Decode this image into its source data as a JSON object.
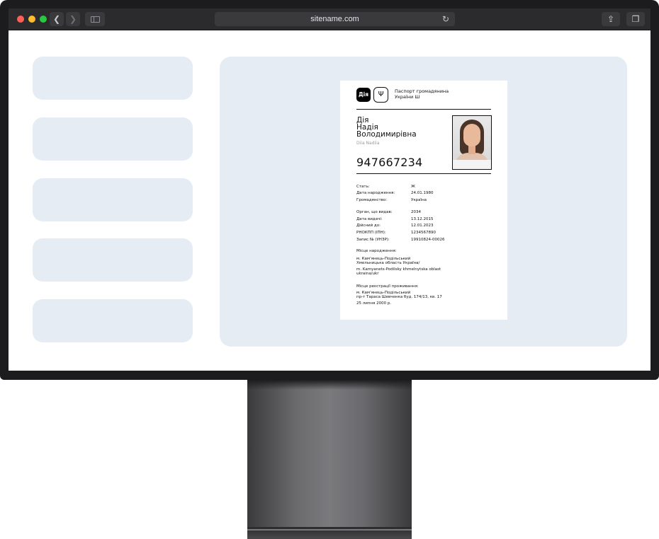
{
  "browser": {
    "url": "sitename.com",
    "icons": {
      "back": "chevron-left-icon",
      "forward": "chevron-right-icon",
      "sidebar": "sidebar-icon",
      "reload": "reload-icon",
      "share": "share-icon",
      "tabs": "tabs-icon"
    }
  },
  "colors": {
    "panel": "#e6ecf3",
    "frame": "#1c1c1e",
    "close": "#ff5f57",
    "minimize": "#febc2e",
    "zoom": "#28c840"
  },
  "document": {
    "logo_text": "Дія",
    "title_line1": "Паспорт громадянина",
    "title_line2": "України Ш",
    "surname": "Дія",
    "given_name": "Надія",
    "patronymic": "Володимирівна",
    "latin_name": "Diia Nadiia",
    "number": "947667234",
    "fields_group1": [
      {
        "label": "Стать:",
        "value": "Ж"
      },
      {
        "label": "Дата народження:",
        "value": "24.01.1980"
      },
      {
        "label": "Громадянство:",
        "value": "Україна"
      }
    ],
    "fields_group2": [
      {
        "label": "Орган, що видав:",
        "value": "2034"
      },
      {
        "label": "Дата видачі:",
        "value": "13.12.2015"
      },
      {
        "label": "Дійсний до:",
        "value": "12.01.2023"
      },
      {
        "label": "РНОКПП (ІПН):",
        "value": "1234567890"
      },
      {
        "label": "Запис № (УНЗР):",
        "value": "19910824-00026"
      }
    ],
    "birthplace_label": "Місце народження:",
    "birthplace_line1": "м. Кам'янець-Подільський",
    "birthplace_line2": "Хмельницька область Україна/",
    "birthplace_line3": "m. Kamyanets-Podilsky khmelnytska oblast",
    "birthplace_line4": "ukraina/ukr",
    "residence_label": "Місце реєстрації проживання:",
    "residence_line1": "м. Кам'янець-Подільський",
    "residence_line2": "пр-т Тараса Шевченка буд. 174/13, кв. 17",
    "residence_date": "25 липня 2000 р."
  }
}
